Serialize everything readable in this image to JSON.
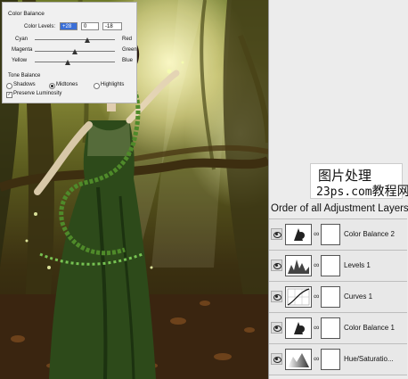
{
  "color_balance": {
    "title": "Color Balance",
    "levels_label": "Color Levels:",
    "levels": [
      "+28",
      "0",
      "-18"
    ],
    "sliders": [
      {
        "left": "Cyan",
        "right": "Red",
        "value": 28
      },
      {
        "left": "Magenta",
        "right": "Green",
        "value": 0
      },
      {
        "left": "Yellow",
        "right": "Blue",
        "value": -18
      }
    ]
  },
  "tone_balance": {
    "title": "Tone Balance",
    "options": [
      "Shadows",
      "Midtones",
      "Highlights"
    ],
    "selected": "Midtones",
    "preserve_label": "Preserve Luminosity",
    "preserve_checked": true
  },
  "watermark": {
    "line1": "图片处理",
    "line2_a": "23ps.com",
    "line2_b": "教程网"
  },
  "layers_panel": {
    "title": "Order of all Adjustment Layers",
    "layers": [
      {
        "name": "Color Balance 2",
        "icon": "color-balance-icon"
      },
      {
        "name": "Levels 1",
        "icon": "levels-icon"
      },
      {
        "name": "Curves 1",
        "icon": "curves-icon"
      },
      {
        "name": "Color Balance 1",
        "icon": "color-balance-icon"
      },
      {
        "name": "Hue/Saturatio...",
        "icon": "hue-saturation-icon"
      }
    ]
  },
  "colors": {
    "panel_bg": "#ececec",
    "selection": "#3a6fd8",
    "forest_dark": "#2a1f0a",
    "dress_green": "#2d4a1a"
  }
}
